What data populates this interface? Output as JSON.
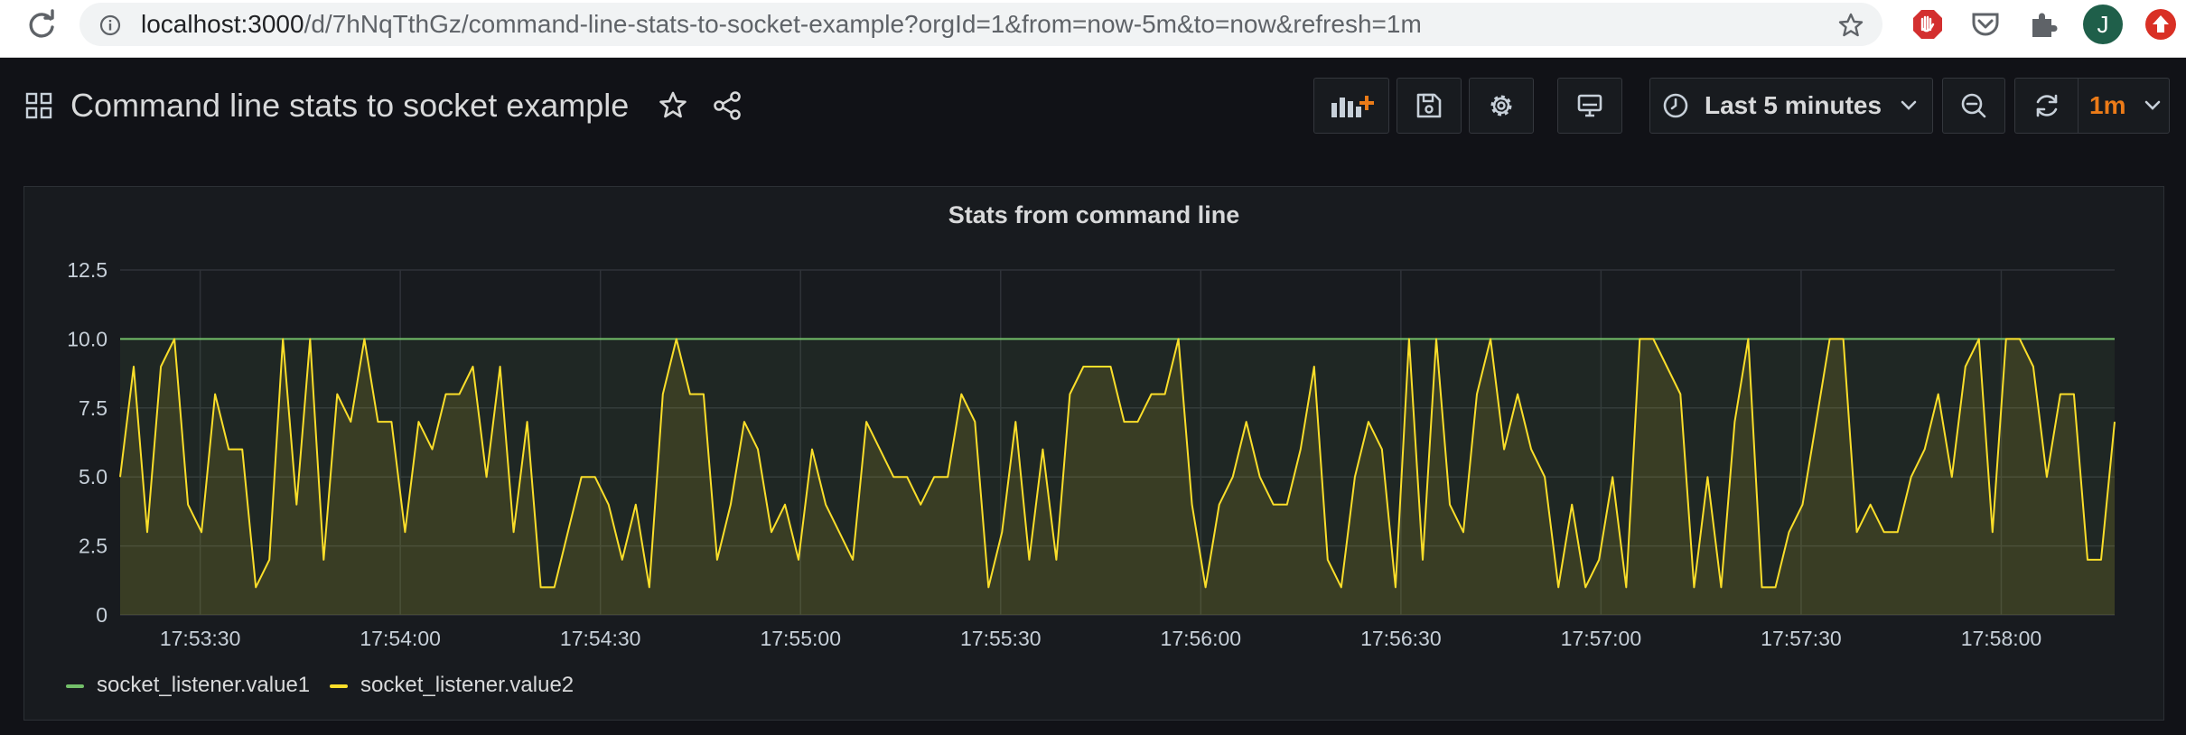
{
  "browser": {
    "url_host": "localhost:3000",
    "url_rest": "/d/7hNqTthGz/command-line-stats-to-socket-example?orgId=1&from=now-5m&to=now&refresh=1m",
    "avatar_initial": "J"
  },
  "dashboard": {
    "title": "Command line stats to socket example",
    "time_range": "Last 5 minutes",
    "refresh_interval": "1m"
  },
  "panel": {
    "title": "Stats from command line"
  },
  "colors": {
    "series1": "#73bf69",
    "series2": "#fade2a",
    "refresh_accent": "#eb7b18"
  },
  "chart_data": {
    "type": "area",
    "title": "Stats from command line",
    "xlabel": "",
    "ylabel": "",
    "ylim": [
      0,
      12.5
    ],
    "yticks": [
      "12.5",
      "10.0",
      "7.5",
      "5.0",
      "2.5",
      "0"
    ],
    "x_start": "17:53:18",
    "x_end": "17:58:17",
    "x_ticks": [
      "17:53:30",
      "17:54:00",
      "17:54:30",
      "17:55:00",
      "17:55:30",
      "17:56:00",
      "17:56:30",
      "17:57:00",
      "17:57:30",
      "17:58:00"
    ],
    "grid": true,
    "legend": "bottom-left",
    "series": [
      {
        "name": "socket_listener.value1",
        "color": "#73bf69",
        "values": [
          10,
          10,
          10,
          10,
          10,
          10,
          10,
          10,
          10,
          10,
          10,
          10,
          10,
          10,
          10,
          10,
          10,
          10,
          10,
          10,
          10,
          10,
          10,
          10,
          10,
          10,
          10,
          10,
          10,
          10,
          10,
          10,
          10,
          10,
          10,
          10,
          10,
          10,
          10,
          10,
          10,
          10,
          10,
          10,
          10,
          10,
          10,
          10,
          10,
          10,
          10,
          10,
          10,
          10,
          10,
          10,
          10,
          10,
          10,
          10,
          10,
          10,
          10,
          10,
          10,
          10,
          10,
          10,
          10,
          10,
          10,
          10,
          10,
          10,
          10,
          10,
          10,
          10,
          10,
          10,
          10,
          10,
          10,
          10,
          10,
          10,
          10,
          10,
          10,
          10,
          10,
          10,
          10,
          10,
          10,
          10,
          10,
          10,
          10,
          10,
          10,
          10,
          10,
          10,
          10,
          10,
          10,
          10,
          10,
          10,
          10,
          10,
          10,
          10,
          10,
          10,
          10,
          10,
          10,
          10,
          10,
          10,
          10,
          10,
          10,
          10,
          10,
          10,
          10,
          10,
          10,
          10,
          10,
          10,
          10,
          10,
          10,
          10,
          10,
          10,
          10,
          10,
          10,
          10,
          10,
          10,
          10,
          10,
          10,
          10
        ]
      },
      {
        "name": "socket_listener.value2",
        "color": "#fade2a",
        "values": [
          5,
          9,
          3,
          9,
          10,
          4,
          3,
          8,
          6,
          6,
          1,
          2,
          10,
          4,
          10,
          2,
          8,
          7,
          10,
          7,
          7,
          3,
          7,
          6,
          8,
          8,
          9,
          5,
          9,
          3,
          7,
          1,
          1,
          3,
          5,
          5,
          4,
          2,
          4,
          1,
          8,
          10,
          8,
          8,
          2,
          4,
          7,
          6,
          3,
          4,
          2,
          6,
          4,
          3,
          2,
          7,
          6,
          5,
          5,
          4,
          5,
          5,
          8,
          7,
          1,
          3,
          7,
          2,
          6,
          2,
          8,
          9,
          9,
          9,
          7,
          7,
          8,
          8,
          10,
          4,
          1,
          4,
          5,
          7,
          5,
          4,
          4,
          6,
          9,
          2,
          1,
          5,
          7,
          6,
          1,
          10,
          2,
          10,
          4,
          3,
          8,
          10,
          6,
          8,
          6,
          5,
          1,
          4,
          1,
          2,
          5,
          1,
          10,
          10,
          9,
          8,
          1,
          5,
          1,
          7,
          10,
          1,
          1,
          3,
          4,
          7,
          10,
          10,
          3,
          4,
          3,
          3,
          5,
          6,
          8,
          5,
          9,
          10,
          3,
          10,
          10,
          9,
          5,
          8,
          8,
          2,
          2,
          7
        ]
      }
    ]
  }
}
